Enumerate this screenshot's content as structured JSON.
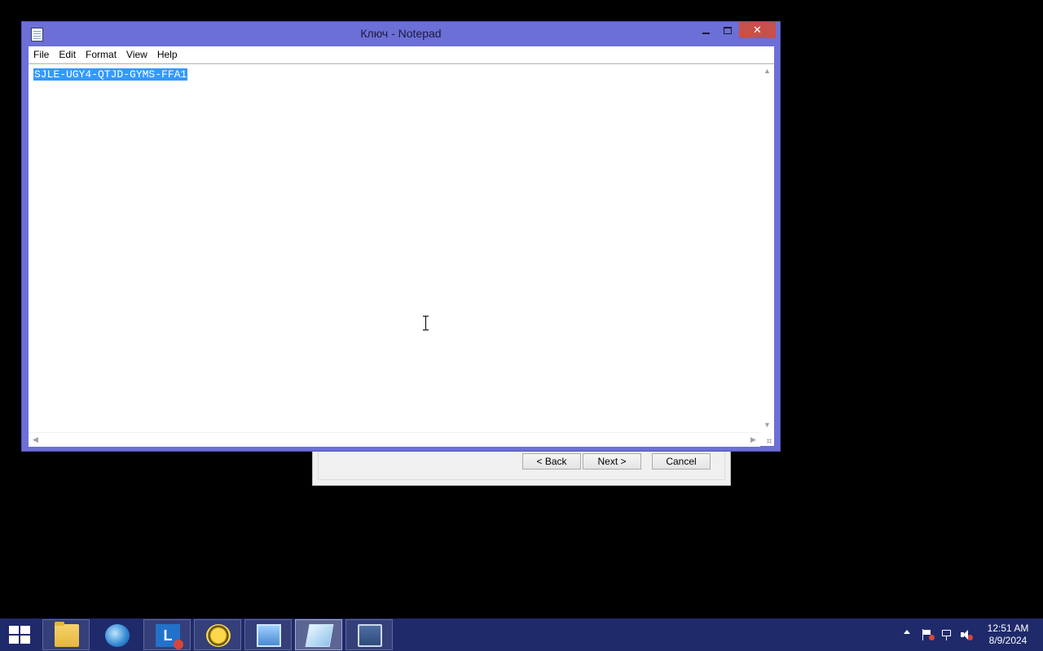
{
  "wizard": {
    "back_label": "< Back",
    "next_label": "Next >",
    "cancel_label": "Cancel"
  },
  "notepad": {
    "title": "Ключ - Notepad",
    "close_glyph": "✕",
    "menu": [
      "File",
      "Edit",
      "Format",
      "View",
      "Help"
    ],
    "content_text": "SJLE-UGY4-QTJD-GYMS-FFA1",
    "content_selected": true
  },
  "taskbar": {
    "apps": [
      {
        "name": "file-explorer",
        "active": false
      },
      {
        "name": "internet-explorer",
        "active": false
      },
      {
        "name": "lync",
        "active": false
      },
      {
        "name": "bee-app",
        "active": false
      },
      {
        "name": "network-app",
        "active": false
      },
      {
        "name": "notepad",
        "active": true
      },
      {
        "name": "setup-app",
        "active": false
      }
    ],
    "clock_time": "12:51 AM",
    "clock_date": "8/9/2024"
  },
  "colors": {
    "window_frame": "#6c6fd6",
    "close_button": "#c7504b",
    "selection": "#3399ff",
    "taskbar": "#1f2a6b"
  }
}
